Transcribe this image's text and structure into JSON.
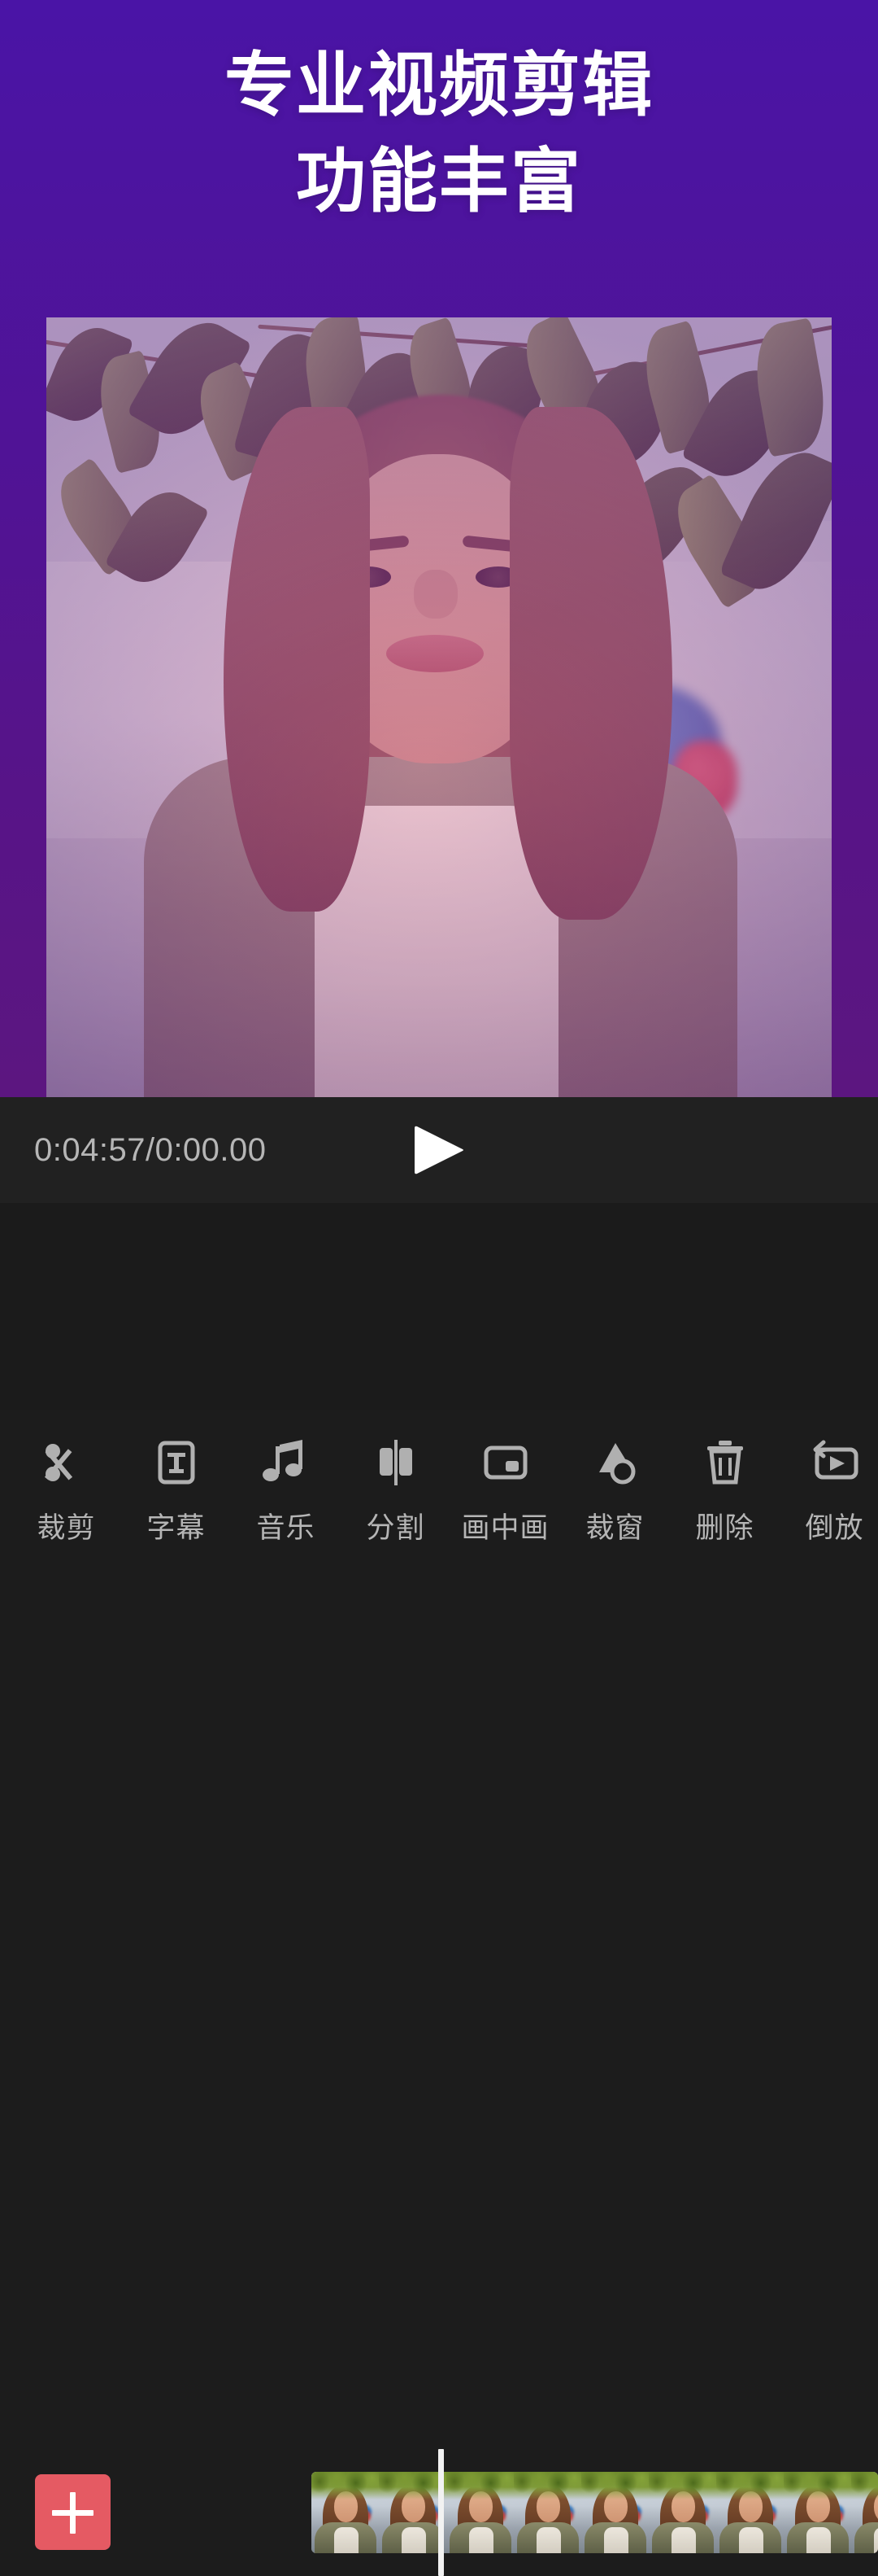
{
  "hero": {
    "headline_line1": "专业视频剪辑",
    "headline_line2": "功能丰富",
    "gradient_top": "#4a14a6",
    "gradient_bottom": "#5c1680"
  },
  "preview": {
    "name": "video-preview",
    "tint": "#9c36aa"
  },
  "controls": {
    "timecode": "0:04:57/0:00.00",
    "play_label": "play"
  },
  "timeline": {
    "add_label": "+",
    "add_color": "#e55a63",
    "playhead_color": "#f2f2f2",
    "thumbnail_count": 9
  },
  "toolbar": {
    "items": [
      {
        "label": "裁剪",
        "icon": "scissors-icon"
      },
      {
        "label": "字幕",
        "icon": "text-box-icon"
      },
      {
        "label": "音乐",
        "icon": "music-note-icon"
      },
      {
        "label": "分割",
        "icon": "split-icon"
      },
      {
        "label": "画中画",
        "icon": "picture-in-picture-icon"
      },
      {
        "label": "裁窗",
        "icon": "mask-shape-icon"
      },
      {
        "label": "删除",
        "icon": "trash-icon"
      },
      {
        "label": "倒放",
        "icon": "reverse-play-icon"
      }
    ],
    "icon_color": "#b0b0b0",
    "label_color": "#b5b5b5"
  }
}
